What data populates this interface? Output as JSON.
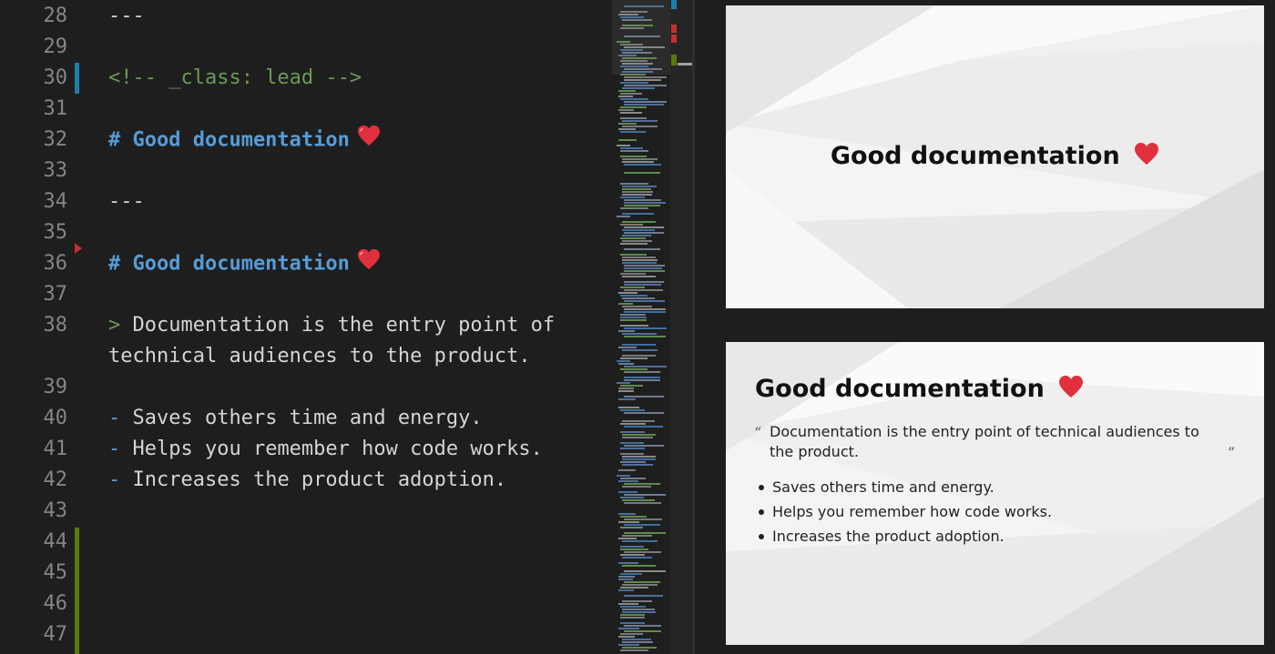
{
  "editor": {
    "lines": [
      {
        "num": "28",
        "kind": "plain",
        "text": "---"
      },
      {
        "num": "29",
        "kind": "blank",
        "text": ""
      },
      {
        "num": "30",
        "kind": "comment",
        "text": "<!-- _class: lead -->"
      },
      {
        "num": "31",
        "kind": "blank",
        "text": ""
      },
      {
        "num": "32",
        "kind": "heading",
        "text": "# Good documentation"
      },
      {
        "num": "33",
        "kind": "blank",
        "text": ""
      },
      {
        "num": "34",
        "kind": "plain",
        "text": "---"
      },
      {
        "num": "35",
        "kind": "blank",
        "text": ""
      },
      {
        "num": "36",
        "kind": "heading",
        "text": "# Good documentation"
      },
      {
        "num": "37",
        "kind": "blank",
        "text": ""
      },
      {
        "num": "38",
        "kind": "quote",
        "marker": ">",
        "text": "Documentation is the entry point of"
      },
      {
        "num": "",
        "kind": "wrap",
        "text": "technical audiences to the product."
      },
      {
        "num": "39",
        "kind": "blank",
        "text": ""
      },
      {
        "num": "40",
        "kind": "bullet",
        "marker": "-",
        "text": "Saves others time and energy."
      },
      {
        "num": "41",
        "kind": "bullet",
        "marker": "-",
        "text": "Helps you remember how code works."
      },
      {
        "num": "42",
        "kind": "bullet",
        "marker": "-",
        "text": "Increases the product adoption."
      },
      {
        "num": "43",
        "kind": "blank",
        "text": ""
      },
      {
        "num": "44",
        "kind": "blank",
        "text": ""
      },
      {
        "num": "45",
        "kind": "blank",
        "text": ""
      },
      {
        "num": "46",
        "kind": "blank",
        "text": ""
      },
      {
        "num": "47",
        "kind": "blank",
        "text": ""
      }
    ],
    "heart_icon": "heart-emoji-icon",
    "colors": {
      "comment": "#6a9955",
      "heading": "#569cd6",
      "text": "#d4d4d4",
      "gutter": "#858585",
      "modified": "#1b81a8",
      "added": "#587c0c",
      "deleted": "#c72e2e"
    }
  },
  "preview": {
    "slide1": {
      "title": "Good documentation"
    },
    "slide2": {
      "title": "Good documentation",
      "quote": "Documentation is the entry point of technical audiences to the product.",
      "quote_open": "“",
      "quote_close": "”",
      "bullets": [
        "Saves others time and energy.",
        "Helps you remember how code works.",
        "Increases the product adoption."
      ]
    },
    "heart_color": "#e0303e"
  }
}
